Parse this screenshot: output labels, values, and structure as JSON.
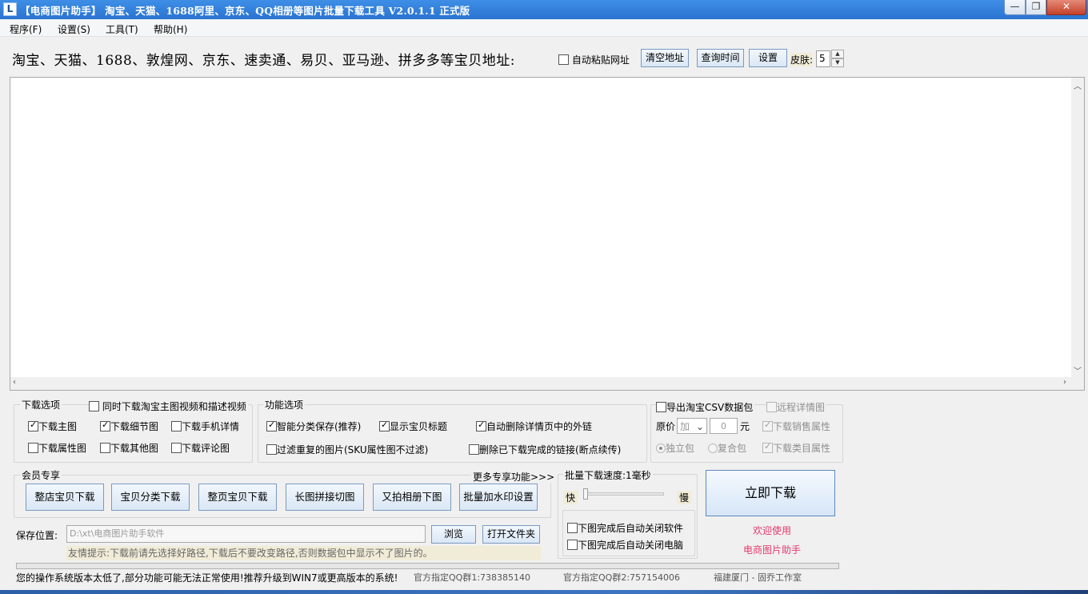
{
  "window": {
    "title": "【电商图片助手】 淘宝、天猫、1688阿里、京东、QQ相册等图片批量下载工具 V2.0.1.1 正式版",
    "icon_glyph": "L",
    "minimize_glyph": "—",
    "restore_glyph": "❐",
    "close_glyph": "✕"
  },
  "menu": [
    "程序(F)",
    "设置(S)",
    "工具(T)",
    "帮助(H)"
  ],
  "top": {
    "url_label": "淘宝、天猫、1688、敦煌网、京东、速卖通、易贝、亚马逊、拼多多等宝贝地址:",
    "auto_paste": {
      "label": "自动粘贴网址",
      "checked": false
    },
    "clear_button": "清空地址",
    "query_time_button": "查询时间",
    "settings_button": "设置",
    "skin_label": "皮肤:",
    "skin_value": "5"
  },
  "download_options": {
    "title": "下载选项",
    "sync_video": {
      "label": "同时下载淘宝主图视频和描述视频",
      "checked": false
    },
    "items": [
      {
        "label": "下载主图",
        "checked": true
      },
      {
        "label": "下载细节图",
        "checked": true
      },
      {
        "label": "下载手机详情",
        "checked": false
      },
      {
        "label": "下载属性图",
        "checked": false
      },
      {
        "label": "下载其他图",
        "checked": false
      },
      {
        "label": "下载评论图",
        "checked": false
      }
    ]
  },
  "function_options": {
    "title": "功能选项",
    "items": [
      {
        "label": "智能分类保存(推荐)",
        "checked": true
      },
      {
        "label": "显示宝贝标题",
        "checked": true
      },
      {
        "label": "自动删除详情页中的外链",
        "checked": true
      },
      {
        "label": "过滤重复的图片(SKU属性图不过滤)",
        "checked": false
      },
      {
        "label": "删除已下载完成的链接(断点续传)",
        "checked": false
      }
    ]
  },
  "csv": {
    "export": {
      "label": "导出淘宝CSV数据包",
      "checked": false
    },
    "remote_detail": {
      "label": "远程详情图",
      "checked": false
    },
    "price_label": "原价",
    "price_op": "加",
    "price_value": "0",
    "unit": "元",
    "sales_attr": {
      "label": "下载销售属性",
      "checked": true
    },
    "radio_single": {
      "label": "独立包",
      "selected": true
    },
    "radio_compound": {
      "label": "复合包",
      "selected": false
    },
    "category_attr": {
      "label": "下载类目属性",
      "checked": true
    }
  },
  "member": {
    "title": "会员专享",
    "more": "更多专享功能>>>",
    "buttons": [
      "整店宝贝下载",
      "宝贝分类下载",
      "整页宝贝下载",
      "长图拼接切图",
      "又拍相册下图",
      "批量加水印设置"
    ]
  },
  "speed": {
    "title": "批量下载速度:1毫秒",
    "fast": "快",
    "slow": "慢",
    "level": 0,
    "close_app": {
      "label": "下图完成后自动关闭软件",
      "checked": false
    },
    "shutdown": {
      "label": "下图完成后自动关闭电脑",
      "checked": false
    }
  },
  "start_button": "立即下载",
  "welcome": "欢迎使用",
  "brand": "电商图片助手",
  "save": {
    "label": "保存位置:",
    "path": "D:\\xt\\电商图片助手软件",
    "browse": "浏览",
    "open_folder": "打开文件夹",
    "tip": "友情提示:下载前请先选择好路径,下载后不要改变路径,否则数据包中显示不了图片的。"
  },
  "status": {
    "os_warning": "您的操作系统版本太低了,部分功能可能无法正常使用!推荐升级到WIN7或更高版本的系统!",
    "qq1": "官方指定QQ群1:738385140",
    "qq2": "官方指定QQ群2:757154006",
    "studio": "福建厦门 - 固乔工作室"
  }
}
